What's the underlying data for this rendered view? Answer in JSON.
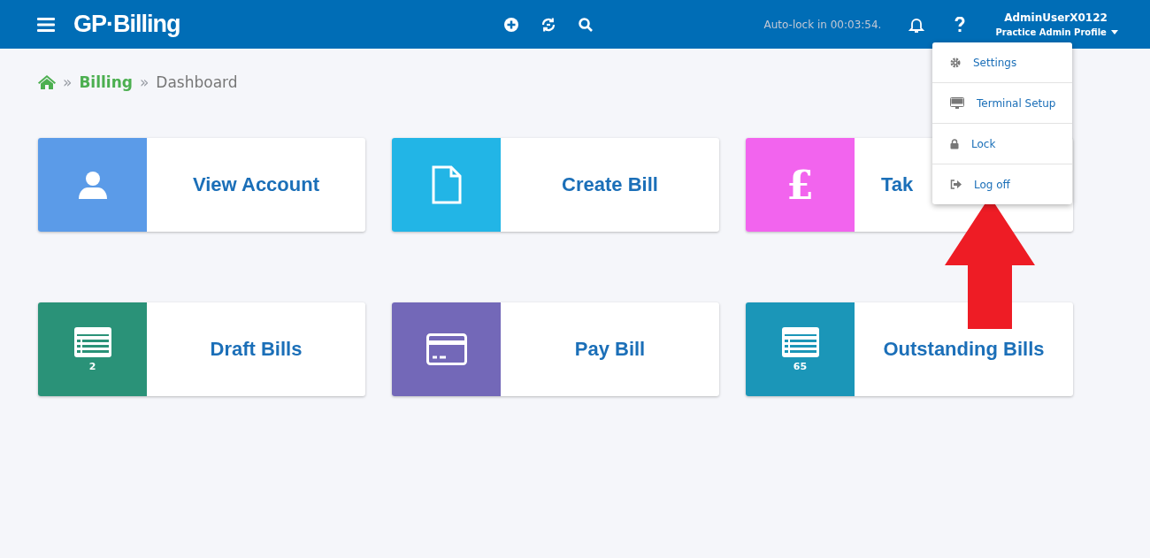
{
  "header": {
    "logo": "GP·Billing",
    "autolock": "Auto-lock in 00:03:54.",
    "user": "AdminUserX0122",
    "profile": "Practice Admin Profile"
  },
  "breadcrumb": {
    "separator": "»",
    "items": [
      "Billing",
      "Dashboard"
    ]
  },
  "tiles": [
    {
      "title": "View Account",
      "kind": "user",
      "color": "#5b9be8"
    },
    {
      "title": "Create Bill",
      "kind": "file",
      "color": "#22b5e6"
    },
    {
      "title": "Tak",
      "kind": "pound",
      "symbol": "£",
      "color": "#f264ee"
    },
    {
      "title": "Draft Bills",
      "kind": "list",
      "count": "2",
      "color": "#2a9278"
    },
    {
      "title": "Pay Bill",
      "kind": "card",
      "color": "#7368b8"
    },
    {
      "title": "Outstanding Bills",
      "kind": "list",
      "count": "65",
      "color": "#1b96b8"
    }
  ],
  "profile_menu": {
    "items": [
      {
        "label": "Settings",
        "kind": "gear"
      },
      {
        "label": "Terminal Setup",
        "kind": "monitor"
      },
      {
        "label": "Lock",
        "kind": "lock"
      },
      {
        "label": "Log off",
        "kind": "logout"
      }
    ]
  }
}
